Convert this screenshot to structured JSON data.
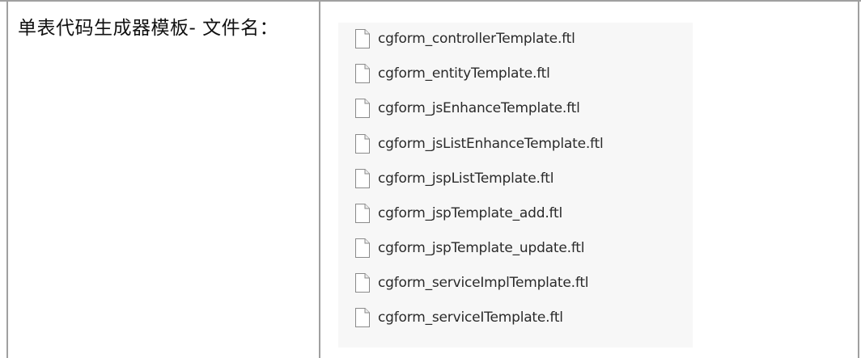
{
  "table": {
    "label": "单表代码生成器模板- 文件名：",
    "files": [
      {
        "name": "cgform_controllerTemplate.ftl",
        "icon": "file-icon"
      },
      {
        "name": "cgform_entityTemplate.ftl",
        "icon": "file-icon"
      },
      {
        "name": "cgform_jsEnhanceTemplate.ftl",
        "icon": "file-icon"
      },
      {
        "name": "cgform_jsListEnhanceTemplate.ftl",
        "icon": "file-icon"
      },
      {
        "name": "cgform_jspListTemplate.ftl",
        "icon": "file-icon"
      },
      {
        "name": "cgform_jspTemplate_add.ftl",
        "icon": "file-icon"
      },
      {
        "name": "cgform_jspTemplate_update.ftl",
        "icon": "file-icon"
      },
      {
        "name": "cgform_serviceImplTemplate.ftl",
        "icon": "file-icon"
      },
      {
        "name": "cgform_serviceITemplate.ftl",
        "icon": "file-icon"
      }
    ]
  },
  "colors": {
    "border": "#a0a0a0",
    "panel_bg": "#f7f7f7",
    "text": "#111111"
  }
}
